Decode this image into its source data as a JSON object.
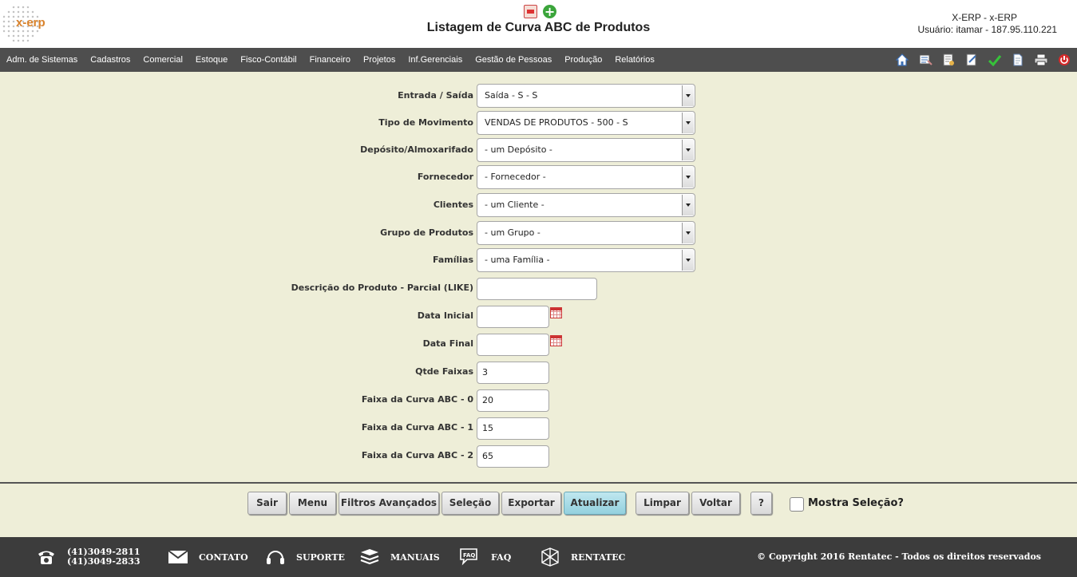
{
  "header": {
    "title": "Listagem de Curva ABC de Produtos",
    "logo_text": "x-erp",
    "system_name": "X-ERP - x-ERP",
    "user_info": "Usuário: itamar - 187.95.110.221"
  },
  "menu": {
    "items": [
      "Adm. de Sistemas",
      "Cadastros",
      "Comercial",
      "Estoque",
      "Fisco-Contábil",
      "Financeiro",
      "Projetos",
      "Inf.Gerenciais",
      "Gestão de Pessoas",
      "Produção",
      "Relatórios"
    ]
  },
  "form": {
    "entrada_saida": {
      "label": "Entrada / Saída",
      "value": "Saída - S - S"
    },
    "tipo_movimento": {
      "label": "Tipo de Movimento",
      "value": "VENDAS DE PRODUTOS - 500 - S"
    },
    "deposito": {
      "label": "Depósito/Almoxarifado",
      "value": "- um Depósito -"
    },
    "fornecedor": {
      "label": "Fornecedor",
      "value": "- Fornecedor -"
    },
    "clientes": {
      "label": "Clientes",
      "value": "- um Cliente -"
    },
    "grupo_produtos": {
      "label": "Grupo de Produtos",
      "value": "- um Grupo -"
    },
    "familias": {
      "label": "Famílias",
      "value": "- uma Família -"
    },
    "descricao": {
      "label": "Descrição do Produto - Parcial (LIKE)",
      "value": ""
    },
    "data_inicial": {
      "label": "Data Inicial",
      "value": ""
    },
    "data_final": {
      "label": "Data Final",
      "value": ""
    },
    "qtde_faixas": {
      "label": "Qtde Faixas",
      "value": "3"
    },
    "faixa_0": {
      "label": "Faixa da Curva ABC - 0",
      "value": "20"
    },
    "faixa_1": {
      "label": "Faixa da Curva ABC - 1",
      "value": "15"
    },
    "faixa_2": {
      "label": "Faixa da Curva ABC - 2",
      "value": "65"
    }
  },
  "buttons": {
    "sair": "Sair",
    "menu": "Menu",
    "filtros": "Filtros Avançados",
    "selecao": "Seleção",
    "exportar": "Exportar",
    "atualizar": "Atualizar",
    "limpar": "Limpar",
    "voltar": "Voltar",
    "help": "?",
    "mostra_selecao": "Mostra Seleção?"
  },
  "footer": {
    "phone1": "(41)3049-2811",
    "phone2": "(41)3049-2833",
    "contato": "CONTATO",
    "suporte": "SUPORTE",
    "manuais": "MANUAIS",
    "faq": "FAQ",
    "faq_icon_text": "FAQ",
    "rentatec": "RENTATEC",
    "copyright": "© Copyright 2016 Rentatec - Todos os direitos reservados"
  },
  "colors": {
    "background": "#eeeed8",
    "menubar": "#4e4e4e",
    "footer": "#3c3c3c",
    "primary_button": "#93d0de"
  },
  "icons": [
    "home-icon",
    "inbox-icon",
    "report-icon",
    "edit-icon",
    "check-icon",
    "document-icon",
    "print-icon",
    "power-icon"
  ]
}
